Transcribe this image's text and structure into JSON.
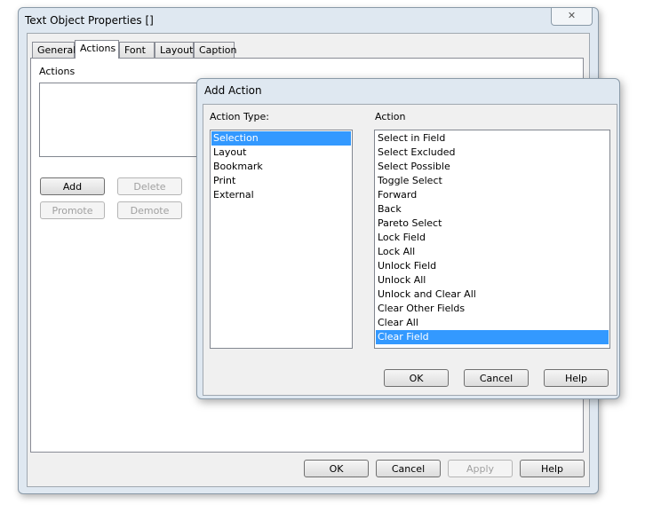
{
  "main_dialog": {
    "title": "Text Object Properties []",
    "tabs": [
      "General",
      "Actions",
      "Font",
      "Layout",
      "Caption"
    ],
    "active_tab": "Actions",
    "actions_label": "Actions",
    "buttons": {
      "add": "Add",
      "delete": "Delete",
      "promote": "Promote",
      "demote": "Demote",
      "ok": "OK",
      "cancel": "Cancel",
      "apply": "Apply",
      "help": "Help"
    }
  },
  "add_action": {
    "title": "Add Action",
    "action_type_label": "Action Type:",
    "action_label": "Action",
    "action_types": [
      "Selection",
      "Layout",
      "Bookmark",
      "Print",
      "External"
    ],
    "selected_type": "Selection",
    "actions": [
      "Select in Field",
      "Select Excluded",
      "Select Possible",
      "Toggle Select",
      "Forward",
      "Back",
      "Pareto Select",
      "Lock Field",
      "Lock All",
      "Unlock Field",
      "Unlock All",
      "Unlock and Clear All",
      "Clear Other Fields",
      "Clear All",
      "Clear Field"
    ],
    "selected_action": "Clear Field",
    "buttons": {
      "ok": "OK",
      "cancel": "Cancel",
      "help": "Help"
    }
  },
  "colors": {
    "selection": "#3399ff"
  }
}
